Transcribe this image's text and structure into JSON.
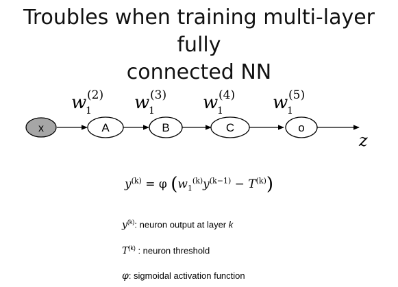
{
  "title": {
    "line1": "Troubles when training multi-layer fully",
    "line2": "connected NN"
  },
  "diagram": {
    "input": "x",
    "nodes": [
      "A",
      "B",
      "C",
      "o"
    ],
    "output": "z",
    "weight_base": "w",
    "weight_sub": "1",
    "weight_supers": [
      "(2)",
      "(3)",
      "(4)",
      "(5)"
    ],
    "input_fill": "#a6a6a6"
  },
  "formula": {
    "lhs": "y",
    "lhs_sup": "(k)",
    "eq": " = φ",
    "w": "w",
    "w_sub": "1",
    "w_sup": "(k)",
    "y2": "y",
    "y2_sup": "(k−1)",
    "minus": " − ",
    "T": "T",
    "T_sup": "(k)"
  },
  "legend": {
    "y_sym": "y",
    "y_sup": "(k)",
    "y_text": ":  neuron output at layer ",
    "y_k": "k",
    "T_sym": "T",
    "T_sup": "(k)",
    "T_text": " : neuron threshold",
    "phi_sym": "φ",
    "phi_text": ": sigmoidal activation function"
  }
}
